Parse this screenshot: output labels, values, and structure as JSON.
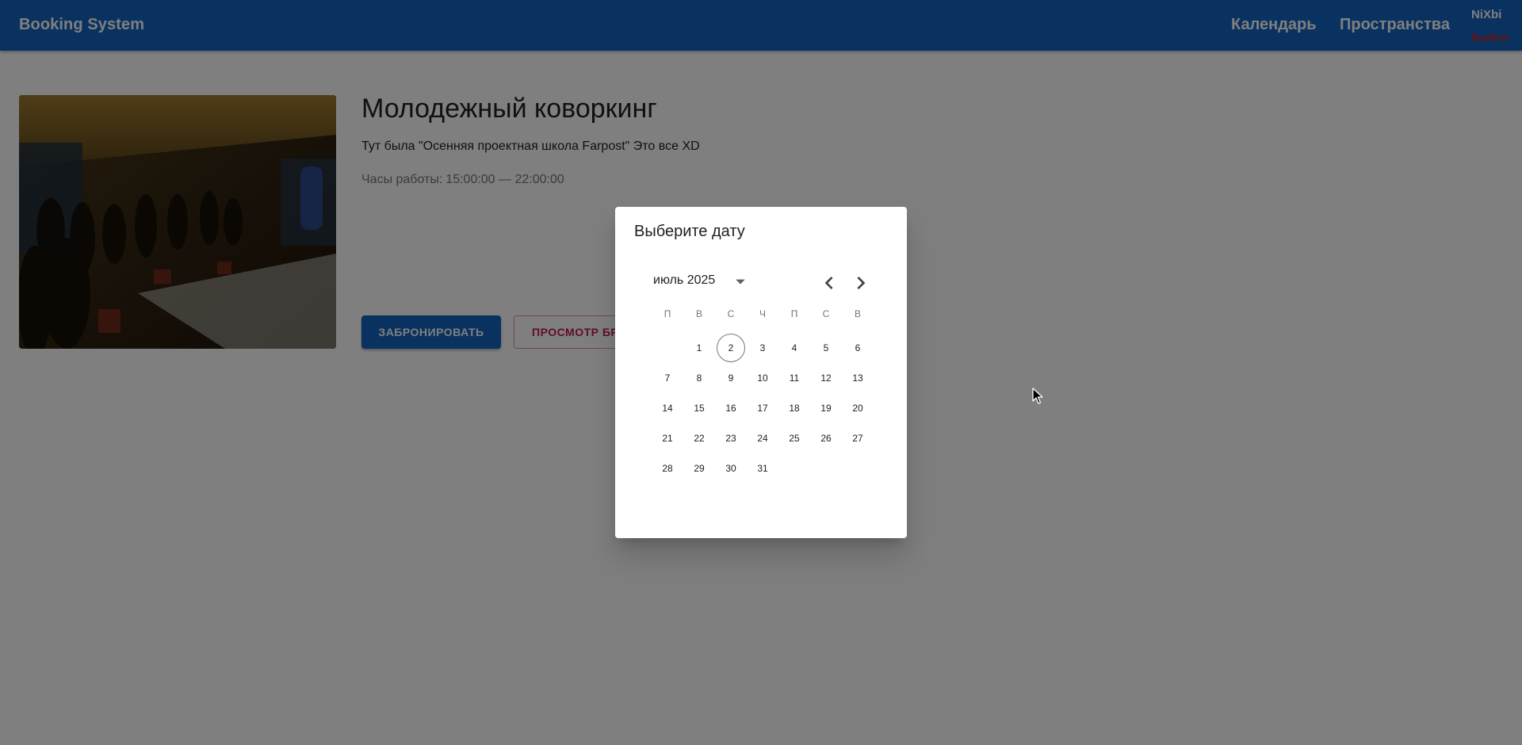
{
  "header": {
    "brand": "Booking System",
    "nav": [
      "Календарь",
      "Пространства"
    ],
    "user": "NiXbi",
    "logout": "Выйти"
  },
  "space": {
    "title": "Молодежный коворкинг",
    "description": "Тут была \"Осенняя проектная школа Farpost\" Это все XD",
    "hours_label": "Часы работы:",
    "hours_value": "15:00:00 — 22:00:00",
    "book_button": "ЗАБРОНИРОВАТЬ",
    "view_button": "ПРОСМОТР БРОНИРОВАНИЙ"
  },
  "date_dialog": {
    "title": "Выберите дату",
    "month_label": "июль 2025",
    "weekdays": [
      "П",
      "В",
      "С",
      "Ч",
      "П",
      "С",
      "В"
    ],
    "first_weekday_index": 1,
    "days_in_month": 31,
    "today": 2,
    "icons": {
      "dropdown": "arrow-drop-down-icon",
      "prev": "chevron-left-icon",
      "next": "chevron-right-icon"
    }
  },
  "colors": {
    "appbar": "#1565c0",
    "primary_button": "#1565c0",
    "outlined_button": "#c2185b",
    "logout": "#c62828"
  }
}
